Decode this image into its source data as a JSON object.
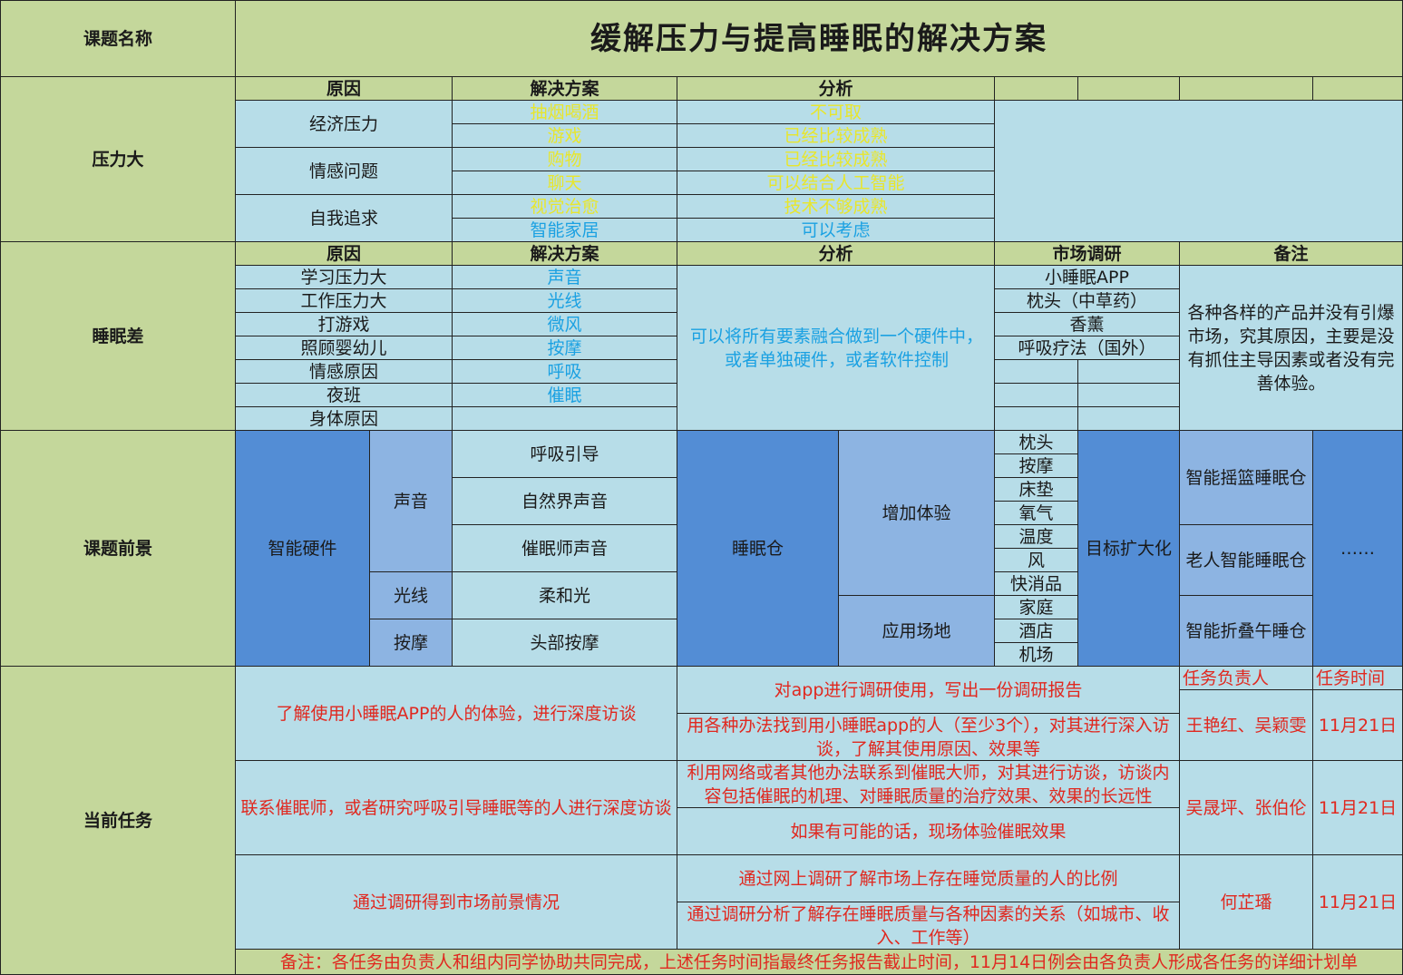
{
  "topic_label": "课题名称",
  "title": "缓解压力与提高睡眠的解决方案",
  "stress": {
    "label": "压力大",
    "headers": [
      "原因",
      "解决方案",
      "分析"
    ],
    "causes": [
      "经济压力",
      "情感问题",
      "自我追求"
    ],
    "solutions": [
      "抽烟喝酒",
      "游戏",
      "购物",
      "聊天",
      "视觉治愈",
      "智能家居"
    ],
    "analyses": [
      "不可取",
      "已经比较成熟",
      "已经比较成熟",
      "可以结合人工智能",
      "技术不够成熟",
      "可以考虑"
    ]
  },
  "sleep": {
    "label": "睡眠差",
    "headers": [
      "原因",
      "解决方案",
      "分析",
      "市场调研",
      "备注"
    ],
    "causes": [
      "学习压力大",
      "工作压力大",
      "打游戏",
      "照顾婴幼儿",
      "情感原因",
      "夜班",
      "身体原因"
    ],
    "solutions": [
      "声音",
      "光线",
      "微风",
      "按摩",
      "呼吸",
      "催眠"
    ],
    "analysis": "可以将所有要素融合做到一个硬件中，或者单独硬件，或者软件控制",
    "market": [
      "小睡眠APP",
      "枕头（中草药）",
      "香薰",
      "呼吸疗法（国外）"
    ],
    "note": "各种各样的产品并没有引爆市场，究其原因，主要是没有抓住主导因素或者没有完善体验。"
  },
  "prospect": {
    "label": "课题前景",
    "hardware": "智能硬件",
    "sound": "声音",
    "sound_items": [
      "呼吸引导",
      "自然界声音",
      "催眠师声音"
    ],
    "light": "光线",
    "light_item": "柔和光",
    "massage": "按摩",
    "massage_item": "头部按摩",
    "pod": "睡眠仓",
    "experience": "增加体验",
    "experience_items": [
      "枕头",
      "按摩",
      "床垫",
      "氧气",
      "温度",
      "风",
      "快消品"
    ],
    "venue": "应用场地",
    "venue_items": [
      "家庭",
      "酒店",
      "机场"
    ],
    "target": "目标扩大化",
    "products": [
      "智能摇篮睡眠仓",
      "老人智能睡眠仓",
      "智能折叠午睡仓"
    ],
    "more": "……"
  },
  "tasks": {
    "label": "当前任务",
    "owner_header": "任务负责人",
    "time_header": "任务时间",
    "groups": [
      {
        "goal": "了解使用小睡眠APP的人的体验，进行深度访谈",
        "steps": [
          "对app进行调研使用，写出一份调研报告",
          "用各种办法找到用小睡眠app的人（至少3个），对其进行深入访谈，了解其使用原因、效果等"
        ],
        "owner": "王艳红、吴颖雯",
        "time": "11月21日"
      },
      {
        "goal": "联系催眠师，或者研究呼吸引导睡眠等的人进行深度访谈",
        "steps": [
          "利用网络或者其他办法联系到催眠大师，对其进行访谈，访谈内容包括催眠的机理、对睡眠质量的治疗效果、效果的长远性",
          "如果有可能的话，现场体验催眠效果"
        ],
        "owner": "吴晟坪、张伯伦",
        "time": "11月21日"
      },
      {
        "goal": "通过调研得到市场前景情况",
        "steps": [
          "通过网上调研了解市场上存在睡觉质量的人的比例",
          "通过调研分析了解存在睡眠质量与各种因素的关系（如城市、收入、工作等）"
        ],
        "owner": "何芷璠",
        "time": "11月21日"
      }
    ],
    "footnote": "备注：各任务由负责人和组内同学协助共同完成，上述任务时间指最终任务报告截止时间，11月14日例会由各负责人形成各任务的详细计划单"
  }
}
